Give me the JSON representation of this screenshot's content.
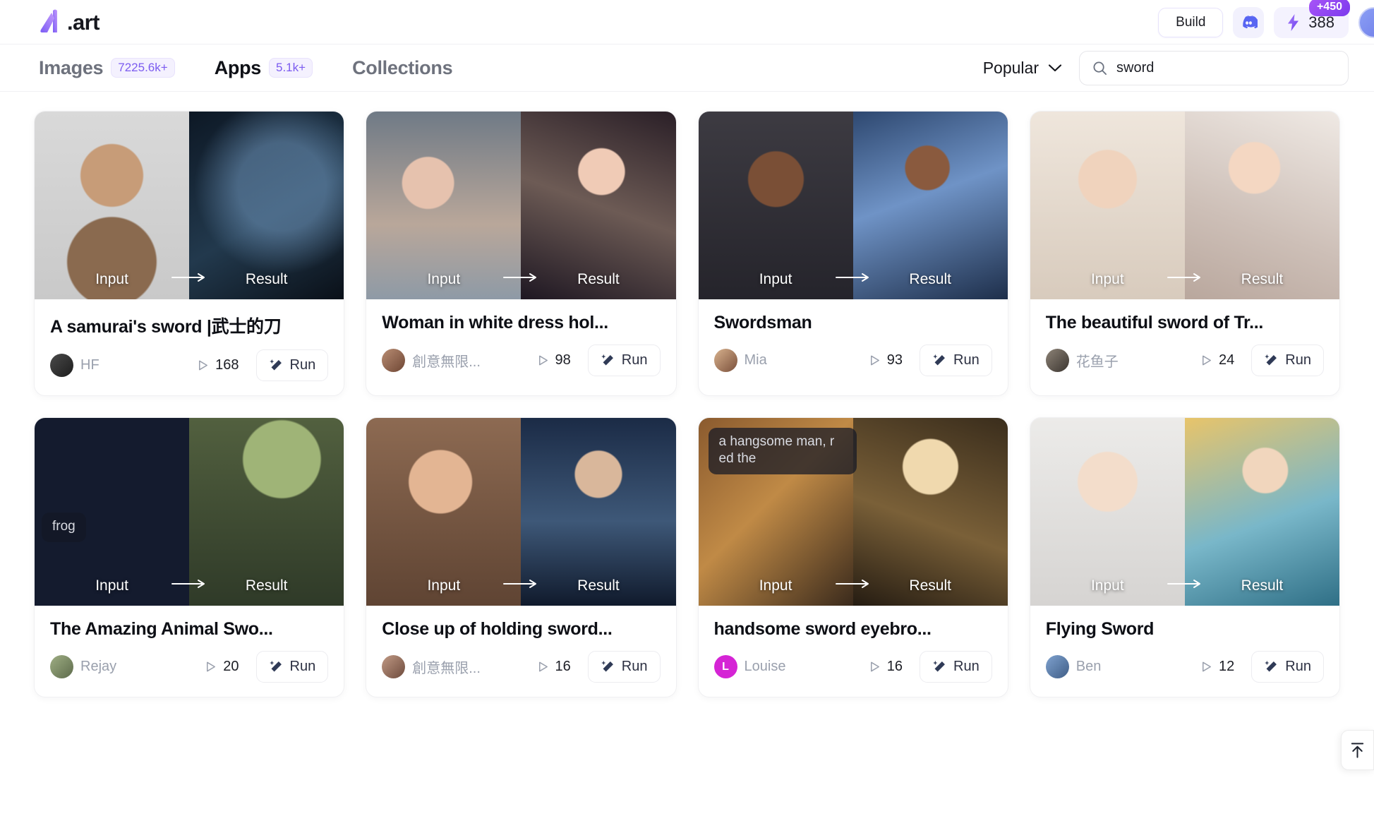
{
  "header": {
    "logo_text": ".art",
    "build_label": "Build",
    "discord_icon": "discord-icon",
    "credits_icon": "lightning-bolt-icon",
    "credits_value": "388",
    "credits_badge": "+450"
  },
  "nav": {
    "items": [
      {
        "label": "Images",
        "count": "7225.6k+",
        "active": false
      },
      {
        "label": "Apps",
        "count": "5.1k+",
        "active": true
      },
      {
        "label": "Collections",
        "count": "",
        "active": false
      }
    ],
    "sort_label": "Popular",
    "sort_icon": "chevron-down-icon",
    "search_icon": "search-icon",
    "search_value": "sword",
    "search_placeholder": "Search"
  },
  "media_labels": {
    "input": "Input",
    "result": "Result",
    "arrow": "arrow-right-icon"
  },
  "run_label": "Run",
  "run_icon": "magic-wand-icon",
  "plays_icon": "play-count-icon",
  "to_top_icon": "scroll-to-top-icon",
  "cards": [
    {
      "title": "A samurai's sword |武士的刀",
      "author": "HF",
      "plays": "168",
      "prompt": ""
    },
    {
      "title": "Woman in white dress hol...",
      "author": "創意無限...",
      "plays": "98",
      "prompt": ""
    },
    {
      "title": "Swordsman",
      "author": "Mia",
      "plays": "93",
      "prompt": ""
    },
    {
      "title": "The beautiful sword of Tr...",
      "author": "花鱼子",
      "plays": "24",
      "prompt": ""
    },
    {
      "title": "The Amazing Animal Swo...",
      "author": "Rejay",
      "plays": "20",
      "prompt": "frog"
    },
    {
      "title": "Close up of holding sword...",
      "author": "創意無限...",
      "plays": "16",
      "prompt": ""
    },
    {
      "title": "handsome sword eyebro...",
      "author": "Louise",
      "plays": "16",
      "prompt": "a hangsome man, r ed the"
    },
    {
      "title": "Flying Sword",
      "author": "Ben",
      "plays": "12",
      "prompt": ""
    }
  ],
  "colors": {
    "accent_purple": "#7c5cf0",
    "badge_purple": "#a855f7",
    "discord_blue": "#5865f2",
    "louise_avatar": "#d524d5"
  }
}
